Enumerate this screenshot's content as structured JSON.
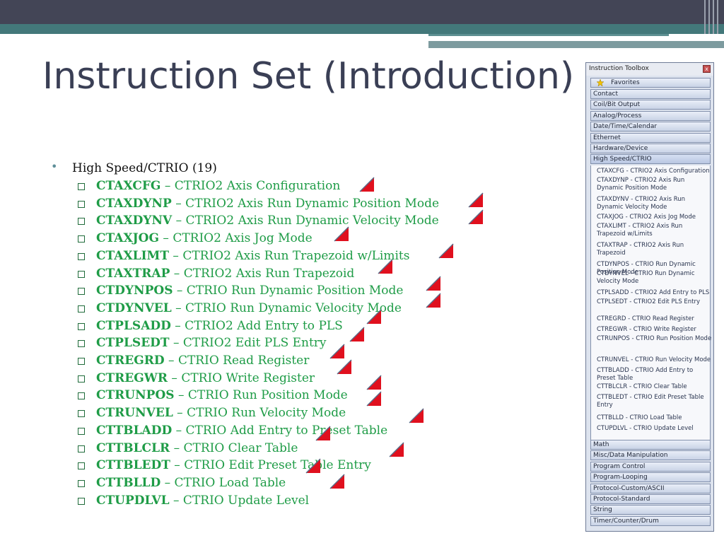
{
  "slide": {
    "title": "Instruction Set (Introduction)",
    "bullet_dot": "•",
    "section_heading": "High Speed/CTRIO (19)",
    "instructions": [
      {
        "code": "CTAXCFG",
        "desc": " – CTRIO2 Axis Configuration"
      },
      {
        "code": "CTAXDYNP",
        "desc": " – CTRIO2 Axis Run Dynamic Position Mode"
      },
      {
        "code": "CTAXDYNV",
        "desc": " – CTRIO2 Axis Run Dynamic Velocity Mode"
      },
      {
        "code": "CTAXJOG",
        "desc": " – CTRIO2 Axis Jog Mode"
      },
      {
        "code": "CTAXLIMT",
        "desc": " – CTRIO2 Axis Run Trapezoid w/Limits"
      },
      {
        "code": "CTAXTRAP",
        "desc": " – CTRIO2 Axis Run Trapezoid"
      },
      {
        "code": "CTDYNPOS",
        "desc": " – CTRIO Run Dynamic Position Mode"
      },
      {
        "code": "CTDYNVEL",
        "desc": " – CTRIO Run Dynamic Velocity Mode"
      },
      {
        "code": "CTPLSADD",
        "desc": " – CTRIO2 Add Entry to PLS"
      },
      {
        "code": "CTPLSEDT",
        "desc": " – CTRIO2 Edit PLS Entry"
      },
      {
        "code": "CTREGRD",
        "desc": " – CTRIO Read Register"
      },
      {
        "code": "CTREGWR",
        "desc": " – CTRIO Write Register"
      },
      {
        "code": "CTRUNPOS",
        "desc": " – CTRIO Run Position Mode"
      },
      {
        "code": "CTRUNVEL",
        "desc": " – CTRIO Run Velocity Mode"
      },
      {
        "code": "CTTBLADD",
        "desc": " – CTRIO Add Entry to Preset Table"
      },
      {
        "code": "CTTBLCLR",
        "desc": " – CTRIO Clear Table"
      },
      {
        "code": "CTTBLEDT",
        "desc": " – CTRIO Edit Preset Table Entry"
      },
      {
        "code": "CTTBLLD",
        "desc": " – CTRIO Load Table"
      },
      {
        "code": "CTUPDLVL",
        "desc": " – CTRIO Update Level"
      }
    ]
  },
  "toolbox": {
    "title": "Instruction Toolbox",
    "close_glyph": "x",
    "favorites": "Favorites",
    "categories_top": [
      "Contact",
      "Coil/Bit Output",
      "Analog/Process",
      "Date/Time/Calendar",
      "Ethernet",
      "Hardware/Device",
      "High Speed/CTRIO"
    ],
    "sub_items": [
      "CTAXCFG - CTRIO2 Axis Configuration",
      "CTAXDYNP - CTRIO2 Axis Run Dynamic Position Mode",
      "CTAXDYNV - CTRIO2 Axis Run Dynamic Velocity Mode",
      "CTAXJOG - CTRIO2 Axis Jog Mode",
      "CTAXLIMT - CTRIO2 Axis Run Trapezoid w/Limits",
      "CTAXTRAP - CTRIO2 Axis Run Trapezoid",
      "CTDYNPOS - CTRIO Run Dynamic Position Mode",
      "CTDYNVEL - CTRIO Run Dynamic Velocity Mode",
      "CTPLSADD - CTRIO2 Add Entry to PLS",
      "CTPLSEDT - CTRIO2 Edit PLS Entry",
      "CTREGRD - CTRIO Read Register",
      "CTREGWR - CTRIO Write Register",
      "CTRUNPOS - CTRIO Run Position Mode",
      "CTRUNVEL - CTRIO Run Velocity Mode",
      "CTTBLADD - CTRIO Add Entry to Preset Table",
      "CTTBLCLR - CTRIO Clear Table",
      "CTTBLEDT - CTRIO Edit Preset Table Entry",
      "CTTBLLD - CTRIO Load Table",
      "CTUPDLVL - CTRIO Update Level"
    ],
    "categories_bottom": [
      "Math",
      "Misc/Data Manipulation",
      "Program Control",
      "Program-Looping",
      "Protocol-Custom/ASCII",
      "Protocol-Standard",
      "String",
      "Timer/Counter/Drum"
    ]
  },
  "colors": {
    "accent_green": "#1f9c47",
    "flag_red": "#e0101e",
    "header_dark": "#434556",
    "header_teal": "#43787a"
  }
}
